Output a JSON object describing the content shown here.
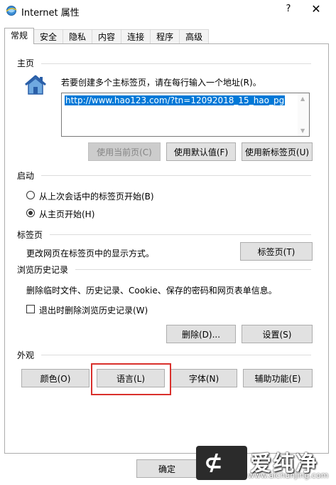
{
  "window": {
    "title": "Internet 属性",
    "help": "?",
    "close": "✕"
  },
  "tabs": [
    {
      "label": "常规"
    },
    {
      "label": "安全"
    },
    {
      "label": "隐私"
    },
    {
      "label": "内容"
    },
    {
      "label": "连接"
    },
    {
      "label": "程序"
    },
    {
      "label": "高级"
    }
  ],
  "home": {
    "label": "主页",
    "instruction": "若要创建多个主标签页，请在每行输入一个地址(R)。",
    "url": "http://www.hao123.com/?tn=12092018_15_hao_pg",
    "btn_current": "使用当前页(C)",
    "btn_default": "使用默认值(F)",
    "btn_newtab": "使用新标签页(U)"
  },
  "startup": {
    "label": "启动",
    "option_last": "从上次会话中的标签页开始(B)",
    "option_home": "从主页开始(H)",
    "selected": "option_home"
  },
  "tabs_section": {
    "label": "标签页",
    "desc": "更改网页在标签页中的显示方式。",
    "btn": "标签页(T)"
  },
  "history": {
    "label": "浏览历史记录",
    "desc": "删除临时文件、历史记录、Cookie、保存的密码和网页表单信息。",
    "checkbox": "退出时删除浏览历史记录(W)",
    "checked": false,
    "btn_delete": "删除(D)...",
    "btn_settings": "设置(S)"
  },
  "appearance": {
    "label": "外观",
    "btn_colors": "颜色(O)",
    "btn_language": "语言(L)",
    "btn_fonts": "字体(N)",
    "btn_accessibility": "辅助功能(E)"
  },
  "footer": {
    "ok": "确定"
  },
  "watermark": {
    "chars": "爱纯净",
    "url": "www.aichunjing.com"
  },
  "colors": {
    "highlight_border": "#d9302c",
    "selection": "#0078d7"
  }
}
